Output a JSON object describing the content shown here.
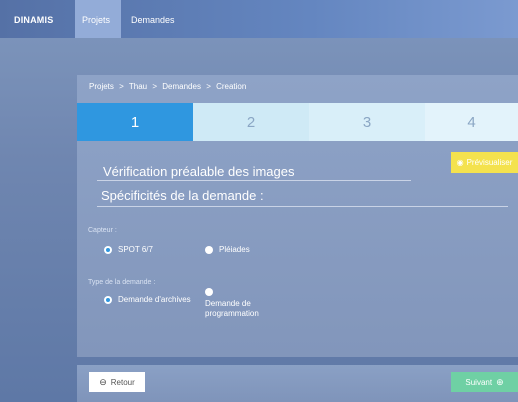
{
  "header": {
    "brand": "DINAMIS",
    "nav": {
      "projets": "Projets",
      "demandes": "Demandes"
    }
  },
  "breadcrumb": {
    "items": [
      "Projets",
      ">",
      "Thau",
      ">",
      "Demandes",
      ">",
      "Creation"
    ]
  },
  "steps": [
    "1",
    "2",
    "3",
    "4"
  ],
  "active_step": 1,
  "form": {
    "section_title": "Vérification préalable des images",
    "subsection_title": "Spécificités de la demande :",
    "preview_button": "Prévisualiser",
    "capteur_label": "Capteur :",
    "capteur_options": [
      "SPOT 6/7",
      "Pléiades"
    ],
    "capteur_selected": "SPOT 6/7",
    "type_label": "Type de la demande :",
    "type_options": [
      "Demande d'archives",
      "Demande de programmation"
    ],
    "type_selected": "Demande d'archives"
  },
  "footer": {
    "back_label": "Retour",
    "next_label": "Suivant"
  },
  "icons": {
    "back": "arrow-left-circle-icon",
    "next": "arrow-right-circle-icon",
    "preview": "eye-icon"
  },
  "colors": {
    "active_step": "#2f97e0",
    "preview_button": "#f4e24e",
    "next_button": "#6fd0a4"
  }
}
